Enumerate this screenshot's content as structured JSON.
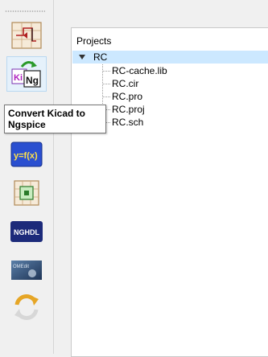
{
  "toolbar": {
    "buttons": [
      {
        "id": "schematic",
        "icon": "schematic-editor-icon"
      },
      {
        "id": "kicad-to-ngspice",
        "icon": "kicad-to-ngspice-icon",
        "ki": "Ki",
        "ng": "Ng"
      },
      {
        "id": "simulate",
        "icon": "simulation-icon"
      },
      {
        "id": "model-editor",
        "icon": "function-yfx-icon",
        "label": "y=f(x)"
      },
      {
        "id": "subcircuit",
        "icon": "subcircuit-icon"
      },
      {
        "id": "nghdl",
        "icon": "nghdl-icon",
        "label": "NGHDL"
      },
      {
        "id": "modelica",
        "icon": "modelica-converter-icon",
        "label": "OMEdit"
      },
      {
        "id": "refresh",
        "icon": "refresh-icon"
      }
    ],
    "tooltip": "Convert Kicad to Ngspice"
  },
  "projects": {
    "header": "Projects",
    "root": "RC",
    "files": [
      "RC-cache.lib",
      "RC.cir",
      "RC.pro",
      "RC.proj",
      "RC.sch"
    ]
  },
  "colors": {
    "selection": "#cce8ff",
    "nghdl_bg": "#1c2a7a",
    "yfx_bg": "#2a4fd0",
    "refresh": "#e0a020"
  }
}
